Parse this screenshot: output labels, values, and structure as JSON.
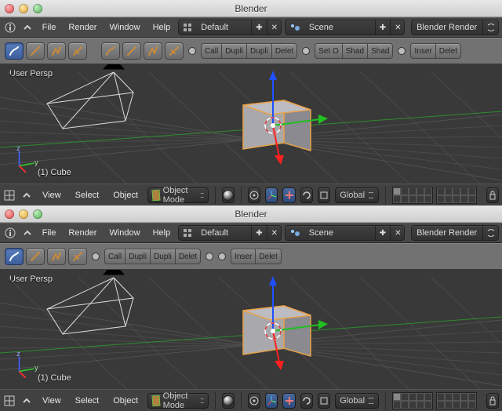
{
  "title": "Blender",
  "top_menu": {
    "file": "File",
    "render": "Render",
    "window": "Window",
    "help": "Help"
  },
  "layout_field": {
    "value": "Default"
  },
  "scene_field": {
    "value": "Scene"
  },
  "engine_field": {
    "value": "Blender Render"
  },
  "toolbar_a_buttons": {
    "b0": "Call",
    "b1": "Dupli",
    "b2": "Dupli",
    "b3": "Delet"
  },
  "toolbar_b_buttons": {
    "b0": "Set O",
    "b1": "Shad",
    "b2": "Shad"
  },
  "toolbar_c_buttons": {
    "b0": "Inser",
    "b1": "Delet"
  },
  "viewport": {
    "persp_label": "User Persp",
    "object_label": "(1) Cube"
  },
  "header3d": {
    "view": "View",
    "select": "Select",
    "object": "Object",
    "mode": "Object Mode",
    "orientation": "Global"
  }
}
